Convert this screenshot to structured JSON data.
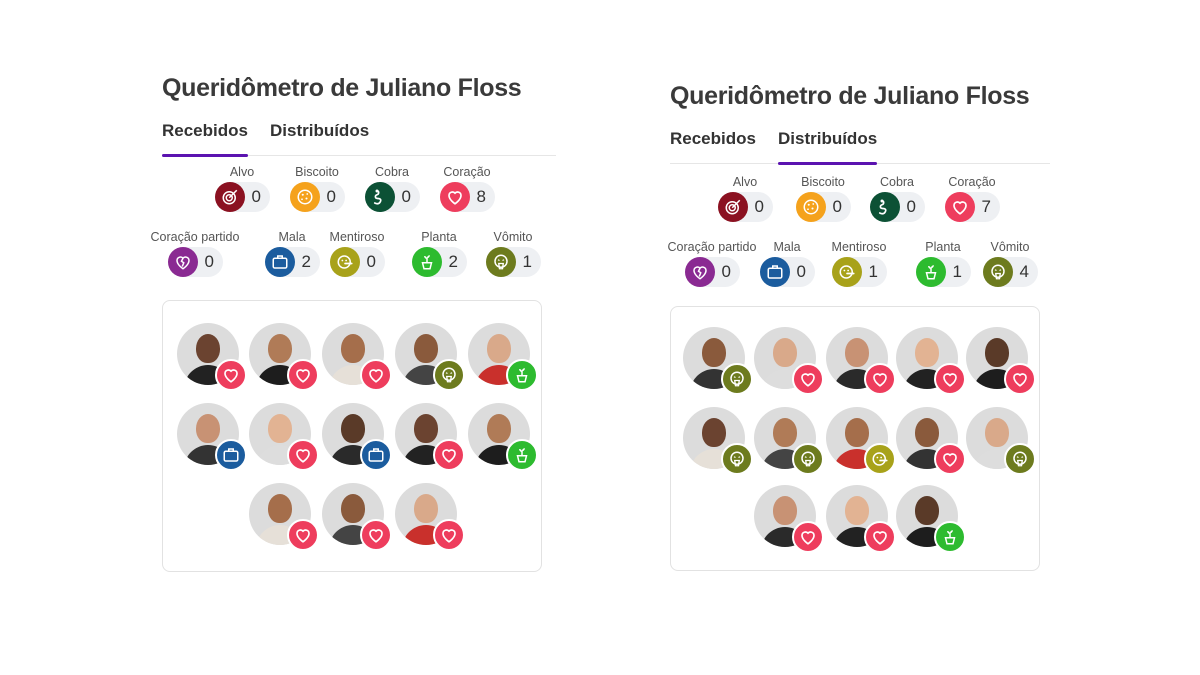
{
  "colors": {
    "accent": "#5b13b0",
    "alvo": "#8b1121",
    "biscoito": "#f5a21c",
    "cobra": "#0c5135",
    "coracao": "#ee3d5d",
    "coracao_partido": "#8a2a92",
    "mala": "#1b5c9e",
    "mentiroso": "#a8a21a",
    "planta": "#2dbb2f",
    "vomito": "#6d7b1e"
  },
  "panels": [
    {
      "title": "Queridômetro de Juliano Floss",
      "tabs": [
        {
          "label": "Recebidos",
          "active": true
        },
        {
          "label": "Distribuídos",
          "active": false
        }
      ],
      "reactions": [
        {
          "label": "Alvo",
          "icon": "target-icon",
          "count": "0"
        },
        {
          "label": "Biscoito",
          "icon": "cookie-icon",
          "count": "0"
        },
        {
          "label": "Cobra",
          "icon": "snake-icon",
          "count": "0"
        },
        {
          "label": "Coração",
          "icon": "heart-icon",
          "count": "8"
        },
        {
          "label": "Coração partido",
          "icon": "broken-heart-icon",
          "count": "0"
        },
        {
          "label": "Mala",
          "icon": "suitcase-icon",
          "count": "2"
        },
        {
          "label": "Mentiroso",
          "icon": "liar-face-icon",
          "count": "0"
        },
        {
          "label": "Planta",
          "icon": "plant-icon",
          "count": "2"
        },
        {
          "label": "Vômito",
          "icon": "vomit-face-icon",
          "count": "1"
        }
      ],
      "participants": [
        {
          "badge": "heart-icon"
        },
        {
          "badge": "heart-icon"
        },
        {
          "badge": "heart-icon"
        },
        {
          "badge": "vomit-face-icon"
        },
        {
          "badge": "plant-icon"
        },
        {
          "badge": "suitcase-icon"
        },
        {
          "badge": "heart-icon"
        },
        {
          "badge": "suitcase-icon"
        },
        {
          "badge": "heart-icon"
        },
        {
          "badge": "plant-icon"
        },
        {
          "badge": "heart-icon"
        },
        {
          "badge": "heart-icon"
        },
        {
          "badge": "heart-icon"
        }
      ]
    },
    {
      "title": "Queridômetro de Juliano Floss",
      "tabs": [
        {
          "label": "Recebidos",
          "active": false
        },
        {
          "label": "Distribuídos",
          "active": true
        }
      ],
      "reactions": [
        {
          "label": "Alvo",
          "icon": "target-icon",
          "count": "0"
        },
        {
          "label": "Biscoito",
          "icon": "cookie-icon",
          "count": "0"
        },
        {
          "label": "Cobra",
          "icon": "snake-icon",
          "count": "0"
        },
        {
          "label": "Coração",
          "icon": "heart-icon",
          "count": "7"
        },
        {
          "label": "Coração partido",
          "icon": "broken-heart-icon",
          "count": "0"
        },
        {
          "label": "Mala",
          "icon": "suitcase-icon",
          "count": "0"
        },
        {
          "label": "Mentiroso",
          "icon": "liar-face-icon",
          "count": "1"
        },
        {
          "label": "Planta",
          "icon": "plant-icon",
          "count": "1"
        },
        {
          "label": "Vômito",
          "icon": "vomit-face-icon",
          "count": "4"
        }
      ],
      "participants": [
        {
          "badge": "vomit-face-icon"
        },
        {
          "badge": "heart-icon"
        },
        {
          "badge": "heart-icon"
        },
        {
          "badge": "heart-icon"
        },
        {
          "badge": "heart-icon"
        },
        {
          "badge": "vomit-face-icon"
        },
        {
          "badge": "vomit-face-icon"
        },
        {
          "badge": "liar-face-icon"
        },
        {
          "badge": "heart-icon"
        },
        {
          "badge": "vomit-face-icon"
        },
        {
          "badge": "heart-icon"
        },
        {
          "badge": "heart-icon"
        },
        {
          "badge": "plant-icon"
        }
      ]
    }
  ]
}
